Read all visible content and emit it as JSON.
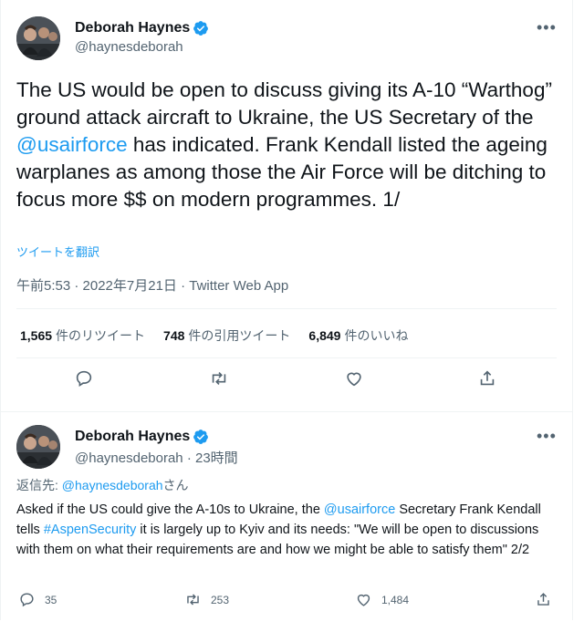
{
  "main_tweet": {
    "author_name": "Deborah Haynes",
    "handle": "@haynesdeborah",
    "text_before_link": "The US would be open to discuss giving its A-10 “Warthog” ground attack aircraft to Ukraine, the US Secretary of the ",
    "mention": "@usairforce",
    "text_after_link": " has indicated. Frank Kendall listed the ageing warplanes as among those the Air Force will be ditching to focus more $$ on modern programmes. 1/",
    "translate_label": "ツイートを翻訳",
    "meta": "午前5:53 · 2022年7月21日 · Twitter Web App",
    "retweets_count": "1,565",
    "retweets_label": "件のリツイート",
    "quotes_count": "748",
    "quotes_label": "件の引用ツイート",
    "likes_count": "6,849",
    "likes_label": "件のいいね",
    "more_label": "•••"
  },
  "reply_tweet": {
    "author_name": "Deborah Haynes",
    "handle_time": "@haynesdeborah · 23時間",
    "reply_prefix": "返信先: ",
    "reply_handle": "@haynesdeborah",
    "reply_suffix": "さん",
    "text_part1": "Asked if the US could give the A-10s to Ukraine, the ",
    "mention": "@usairforce",
    "text_part2": " Secretary Frank Kendall tells ",
    "hashtag": "#AspenSecurity",
    "text_part3": " it is largely up to Kyiv and its needs: \"We will be open to discussions with them on what their requirements are and how we might be able to satisfy them\" 2/2",
    "reply_count": "35",
    "retweet_count": "253",
    "like_count": "1,484",
    "more_label": "•••"
  },
  "icons": {
    "verified": "verified-badge-icon",
    "reply": "reply-icon",
    "retweet": "retweet-icon",
    "like": "heart-icon",
    "share": "share-icon"
  },
  "colors": {
    "accent": "#1d9bf0",
    "text": "#0f1419",
    "secondary": "#536471",
    "border": "#eff3f4"
  }
}
